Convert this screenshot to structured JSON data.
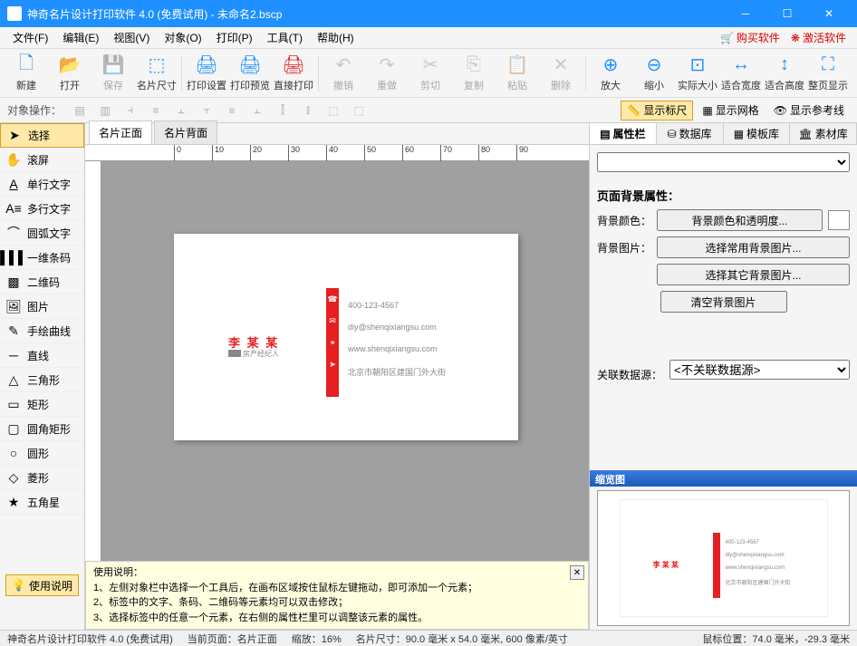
{
  "titlebar": {
    "title": "神奇名片设计打印软件 4.0 (免费试用)  -  未命名2.bscp"
  },
  "menu": {
    "file": "文件(F)",
    "edit": "编辑(E)",
    "view": "视图(V)",
    "object": "对象(O)",
    "print": "打印(P)",
    "tool": "工具(T)",
    "help": "帮助(H)",
    "buy": "购买软件",
    "activate": "激活软件"
  },
  "toolbar": {
    "new": "新建",
    "open": "打开",
    "save": "保存",
    "cardsize": "名片尺寸",
    "printsetup": "打印设置",
    "printpreview": "打印预览",
    "directprint": "直接打印",
    "undo": "撤销",
    "redo": "重做",
    "cut": "剪切",
    "copy": "复制",
    "paste": "粘贴",
    "delete": "删除",
    "zoomin": "放大",
    "zoomout": "缩小",
    "actualsize": "实际大小",
    "fitwidth": "适合宽度",
    "fitheight": "适合高度",
    "fitall": "整页显示"
  },
  "toolbar2": {
    "label": "对象操作：",
    "ruler": "显示标尺",
    "grid": "显示网格",
    "guide": "显示参考线"
  },
  "left": {
    "select": "选择",
    "pan": "滚屏",
    "text": "单行文字",
    "multitext": "多行文字",
    "arctext": "圆弧文字",
    "barcode": "一维条码",
    "qrcode": "二维码",
    "image": "图片",
    "freehand": "手绘曲线",
    "line": "直线",
    "triangle": "三角形",
    "rect": "矩形",
    "roundrect": "圆角矩形",
    "ellipse": "圆形",
    "diamond": "菱形",
    "star": "五角星",
    "help": "使用说明"
  },
  "tabs": {
    "front": "名片正面",
    "back": "名片背面"
  },
  "ruler": {
    "t0": "0",
    "t10": "10",
    "t20": "20",
    "t30": "30",
    "t40": "40",
    "t50": "50",
    "t60": "60",
    "t70": "70",
    "t80": "80",
    "t90": "90"
  },
  "card": {
    "name": "李 某 某",
    "subtitle": "房产经纪人",
    "phone": "400-123-4567",
    "email": "diy@shenqixiangsu.com",
    "web": "www.shenqixiangsu.com",
    "addr": "北京市朝阳区建国门外大街"
  },
  "helpbox": {
    "title": "使用说明：",
    "l1": "1、左侧对象栏中选择一个工具后，在画布区域按住鼠标左键拖动，即可添加一个元素；",
    "l2": "2、标签中的文字、条码、二维码等元素均可以双击修改；",
    "l3": "3、选择标签中的任意一个元素，在右侧的属性栏里可以调整该元素的属性。"
  },
  "rtabs": {
    "prop": "属性栏",
    "db": "数据库",
    "tpl": "模板库",
    "mat": "素材库"
  },
  "right": {
    "sectitle": "页面背景属性：",
    "bgcolor_lbl": "背景颜色：",
    "bgcolor_btn": "背景颜色和透明度...",
    "bgimg_lbl": "背景图片：",
    "bgimg_btn1": "选择常用背景图片...",
    "bgimg_btn2": "选择其它背景图片...",
    "bgimg_btn3": "清空背景图片",
    "ds_lbl": "关联数据源：",
    "ds_val": "<不关联数据源>",
    "preview_title": "缩览图"
  },
  "status": {
    "app": "神奇名片设计打印软件 4.0 (免费试用)",
    "page": "当前页面：名片正面",
    "zoom": "缩放：16%",
    "size": "名片尺寸：90.0 毫米 x 54.0 毫米, 600 像素/英寸",
    "mouse": "鼠标位置：74.0 毫米，-29.3 毫米"
  }
}
